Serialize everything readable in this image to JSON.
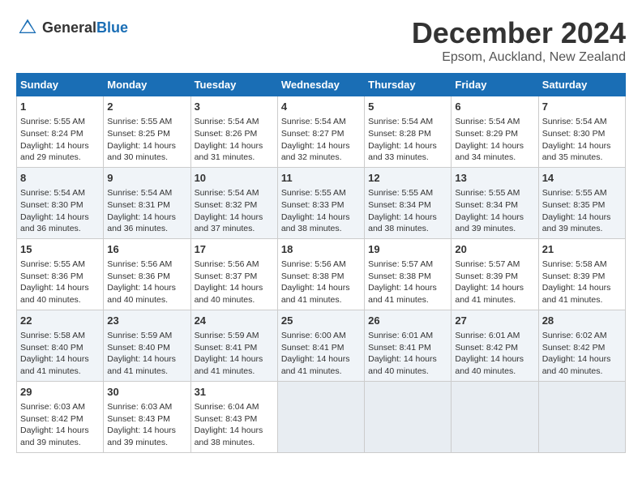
{
  "logo": {
    "text_general": "General",
    "text_blue": "Blue"
  },
  "title": "December 2024",
  "location": "Epsom, Auckland, New Zealand",
  "days_of_week": [
    "Sunday",
    "Monday",
    "Tuesday",
    "Wednesday",
    "Thursday",
    "Friday",
    "Saturday"
  ],
  "weeks": [
    [
      {
        "day": "1",
        "info": "Sunrise: 5:55 AM\nSunset: 8:24 PM\nDaylight: 14 hours\nand 29 minutes."
      },
      {
        "day": "2",
        "info": "Sunrise: 5:55 AM\nSunset: 8:25 PM\nDaylight: 14 hours\nand 30 minutes."
      },
      {
        "day": "3",
        "info": "Sunrise: 5:54 AM\nSunset: 8:26 PM\nDaylight: 14 hours\nand 31 minutes."
      },
      {
        "day": "4",
        "info": "Sunrise: 5:54 AM\nSunset: 8:27 PM\nDaylight: 14 hours\nand 32 minutes."
      },
      {
        "day": "5",
        "info": "Sunrise: 5:54 AM\nSunset: 8:28 PM\nDaylight: 14 hours\nand 33 minutes."
      },
      {
        "day": "6",
        "info": "Sunrise: 5:54 AM\nSunset: 8:29 PM\nDaylight: 14 hours\nand 34 minutes."
      },
      {
        "day": "7",
        "info": "Sunrise: 5:54 AM\nSunset: 8:30 PM\nDaylight: 14 hours\nand 35 minutes."
      }
    ],
    [
      {
        "day": "8",
        "info": "Sunrise: 5:54 AM\nSunset: 8:30 PM\nDaylight: 14 hours\nand 36 minutes."
      },
      {
        "day": "9",
        "info": "Sunrise: 5:54 AM\nSunset: 8:31 PM\nDaylight: 14 hours\nand 36 minutes."
      },
      {
        "day": "10",
        "info": "Sunrise: 5:54 AM\nSunset: 8:32 PM\nDaylight: 14 hours\nand 37 minutes."
      },
      {
        "day": "11",
        "info": "Sunrise: 5:55 AM\nSunset: 8:33 PM\nDaylight: 14 hours\nand 38 minutes."
      },
      {
        "day": "12",
        "info": "Sunrise: 5:55 AM\nSunset: 8:34 PM\nDaylight: 14 hours\nand 38 minutes."
      },
      {
        "day": "13",
        "info": "Sunrise: 5:55 AM\nSunset: 8:34 PM\nDaylight: 14 hours\nand 39 minutes."
      },
      {
        "day": "14",
        "info": "Sunrise: 5:55 AM\nSunset: 8:35 PM\nDaylight: 14 hours\nand 39 minutes."
      }
    ],
    [
      {
        "day": "15",
        "info": "Sunrise: 5:55 AM\nSunset: 8:36 PM\nDaylight: 14 hours\nand 40 minutes."
      },
      {
        "day": "16",
        "info": "Sunrise: 5:56 AM\nSunset: 8:36 PM\nDaylight: 14 hours\nand 40 minutes."
      },
      {
        "day": "17",
        "info": "Sunrise: 5:56 AM\nSunset: 8:37 PM\nDaylight: 14 hours\nand 40 minutes."
      },
      {
        "day": "18",
        "info": "Sunrise: 5:56 AM\nSunset: 8:38 PM\nDaylight: 14 hours\nand 41 minutes."
      },
      {
        "day": "19",
        "info": "Sunrise: 5:57 AM\nSunset: 8:38 PM\nDaylight: 14 hours\nand 41 minutes."
      },
      {
        "day": "20",
        "info": "Sunrise: 5:57 AM\nSunset: 8:39 PM\nDaylight: 14 hours\nand 41 minutes."
      },
      {
        "day": "21",
        "info": "Sunrise: 5:58 AM\nSunset: 8:39 PM\nDaylight: 14 hours\nand 41 minutes."
      }
    ],
    [
      {
        "day": "22",
        "info": "Sunrise: 5:58 AM\nSunset: 8:40 PM\nDaylight: 14 hours\nand 41 minutes."
      },
      {
        "day": "23",
        "info": "Sunrise: 5:59 AM\nSunset: 8:40 PM\nDaylight: 14 hours\nand 41 minutes."
      },
      {
        "day": "24",
        "info": "Sunrise: 5:59 AM\nSunset: 8:41 PM\nDaylight: 14 hours\nand 41 minutes."
      },
      {
        "day": "25",
        "info": "Sunrise: 6:00 AM\nSunset: 8:41 PM\nDaylight: 14 hours\nand 41 minutes."
      },
      {
        "day": "26",
        "info": "Sunrise: 6:01 AM\nSunset: 8:41 PM\nDaylight: 14 hours\nand 40 minutes."
      },
      {
        "day": "27",
        "info": "Sunrise: 6:01 AM\nSunset: 8:42 PM\nDaylight: 14 hours\nand 40 minutes."
      },
      {
        "day": "28",
        "info": "Sunrise: 6:02 AM\nSunset: 8:42 PM\nDaylight: 14 hours\nand 40 minutes."
      }
    ],
    [
      {
        "day": "29",
        "info": "Sunrise: 6:03 AM\nSunset: 8:42 PM\nDaylight: 14 hours\nand 39 minutes."
      },
      {
        "day": "30",
        "info": "Sunrise: 6:03 AM\nSunset: 8:43 PM\nDaylight: 14 hours\nand 39 minutes."
      },
      {
        "day": "31",
        "info": "Sunrise: 6:04 AM\nSunset: 8:43 PM\nDaylight: 14 hours\nand 38 minutes."
      },
      {
        "day": "",
        "info": ""
      },
      {
        "day": "",
        "info": ""
      },
      {
        "day": "",
        "info": ""
      },
      {
        "day": "",
        "info": ""
      }
    ]
  ]
}
